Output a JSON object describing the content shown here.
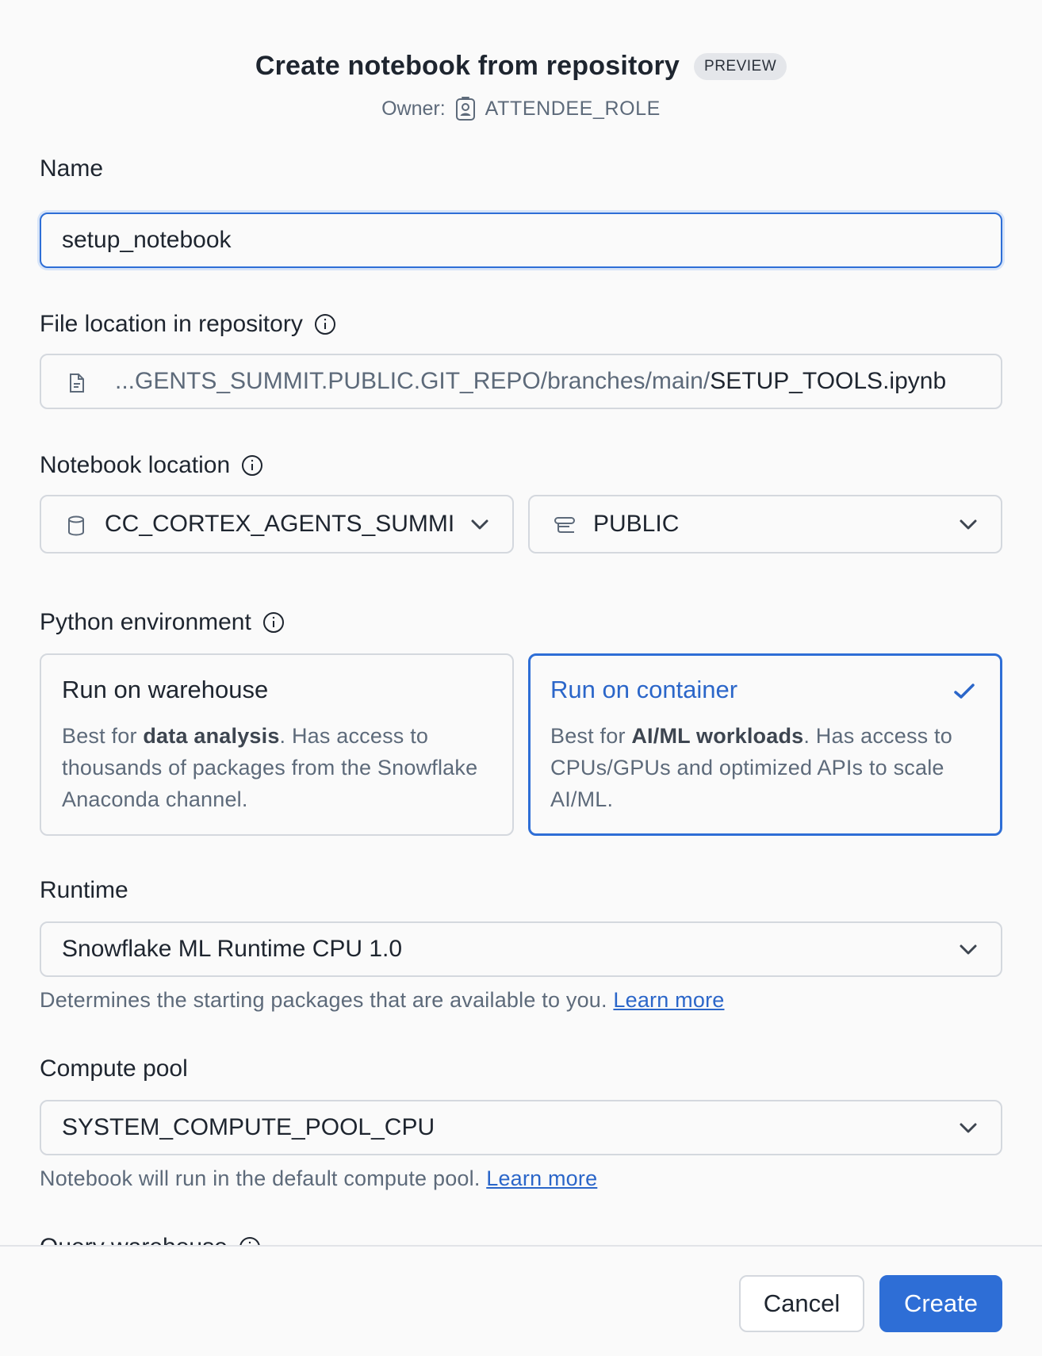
{
  "dialog": {
    "title": "Create notebook from repository",
    "badge": "PREVIEW",
    "owner_label": "Owner:",
    "owner_value": "ATTENDEE_ROLE"
  },
  "name": {
    "label": "Name",
    "value": "setup_notebook"
  },
  "file_location": {
    "label": "File location in repository",
    "path_muted": "...GENTS_SUMMIT.PUBLIC.GIT_REPO/branches/main/",
    "path_file": "SETUP_TOOLS.ipynb"
  },
  "notebook_location": {
    "label": "Notebook location",
    "database": "CC_CORTEX_AGENTS_SUMMI",
    "schema": "PUBLIC"
  },
  "python_environment": {
    "label": "Python environment",
    "options": [
      {
        "title": "Run on warehouse",
        "desc_prefix": "Best for ",
        "desc_bold": "data analysis",
        "desc_suffix": ". Has access to thousands of packages from the Snowflake Anaconda channel.",
        "selected": false
      },
      {
        "title": "Run on container",
        "desc_prefix": "Best for ",
        "desc_bold": "AI/ML workloads",
        "desc_suffix": ". Has access to CPUs/GPUs and optimized APIs to scale AI/ML.",
        "selected": true
      }
    ]
  },
  "runtime": {
    "label": "Runtime",
    "value": "Snowflake ML Runtime CPU 1.0",
    "helper": "Determines the starting packages that are available to you.",
    "link": "Learn more"
  },
  "compute_pool": {
    "label": "Compute pool",
    "value": "SYSTEM_COMPUTE_POOL_CPU",
    "helper": "Notebook will run in the default compute pool.",
    "link": "Learn more"
  },
  "query_warehouse": {
    "label": "Query warehouse"
  },
  "footer": {
    "cancel": "Cancel",
    "create": "Create"
  },
  "colors": {
    "accent": "#2e6ed6",
    "link": "#2b66c9",
    "muted_text": "#5d6a7a",
    "border": "#d4d8de"
  },
  "icons": [
    "badge-person-icon",
    "info-icon",
    "file-icon",
    "database-icon",
    "schema-icon",
    "chevron-down-icon",
    "check-icon"
  ]
}
